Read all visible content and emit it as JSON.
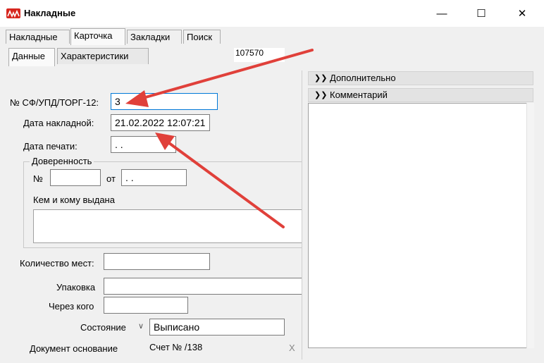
{
  "window": {
    "title": "Накладные",
    "minimize_glyph": "—",
    "maximize_glyph": "☐",
    "close_glyph": "✕"
  },
  "tabs": [
    "Накладные",
    "Карточка",
    "Закладки",
    "Поиск"
  ],
  "subtabs": [
    "Данные",
    "Характеристики"
  ],
  "record_number": "107570",
  "form": {
    "invoice_label": "№ СФ/УПД/ТОРГ-12:",
    "invoice_value": "3",
    "date_label": "Дата накладной:",
    "date_value": "21.02.2022 12:07:21",
    "print_date_label": "Дата печати:",
    "print_date_value": " .  .",
    "power_group_title": "Доверенность",
    "power_no_label": "№",
    "power_no_value": "",
    "power_from_label": "от",
    "power_date_value": " .  .",
    "issued_label": "Кем и кому выдана",
    "issued_value": "",
    "places_label": "Количество мест:",
    "places_value": "",
    "packing_label": "Упаковка",
    "packing_value": "",
    "via_label": "Через кого",
    "via_value": "",
    "state_label": "Состояние",
    "state_value": "Выписано",
    "basis_label": "Документ основание",
    "basis_value": "Счет №  /138",
    "basis_clear": "X"
  },
  "right_panel": {
    "additional": "Дополнительно",
    "comment": "Комментарий",
    "comment_value": ""
  },
  "colors": {
    "arrow": "#e0403a",
    "accent": "#0078d7",
    "icon": "#d7261e"
  }
}
